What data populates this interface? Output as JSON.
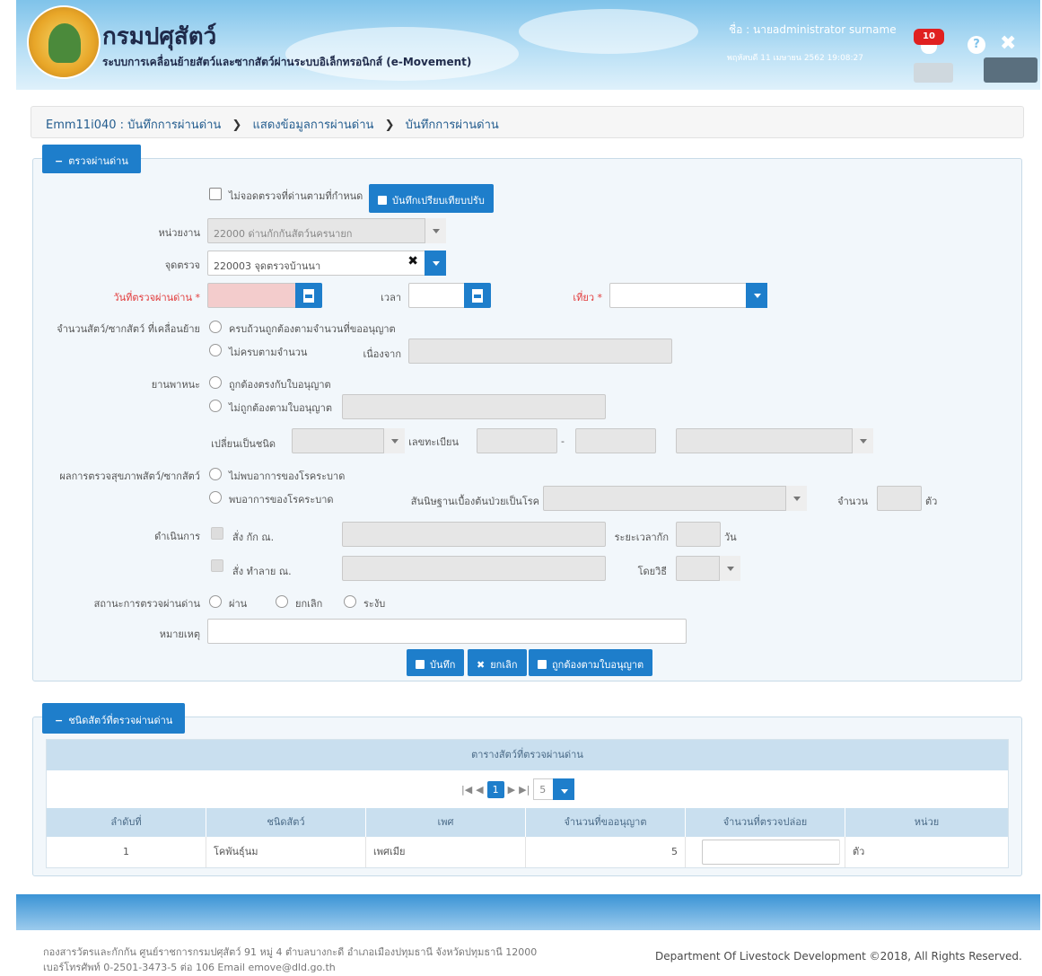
{
  "header": {
    "title": "กรมปศุสัตว์",
    "subtitle": "ระบบการเคลื่อนย้ายสัตว์และซากสัตว์ผ่านระบบอิเล็กทรอนิกส์ (e-Movement)",
    "user": "ชื่อ : นายadministrator surname",
    "datetime": "พฤหัสบดี 11 เมษายน 2562 19:08:27",
    "notification_count": "10"
  },
  "breadcrumb": {
    "items": [
      "Emm11i040 : บันทึกการผ่านด่าน",
      "แสดงข้อมูลการผ่านด่าน",
      "บันทึกการผ่านด่าน"
    ]
  },
  "inspection": {
    "legend": "ตรวจผ่านด่าน",
    "not_at_checkpoint": "ไม่จอดตรวจที่ด่านตามที่กำหนด",
    "save_fine_button": "บันทึกเปรียบเทียบปรับ",
    "unit_label": "หน่วยงาน",
    "unit_value": "22000 ด่านกักกันสัตว์นครนายก",
    "checkpoint_label": "จุดตรวจ",
    "checkpoint_value": "220003 จุดตรวจบ้านนา",
    "date_label": "วันที่ตรวจผ่านด่าน *",
    "time_label": "เวลา",
    "trip_label": "เที่ยว *",
    "animal_count_label": "จำนวนสัตว์/ซากสัตว์ ที่เคลื่อนย้าย",
    "count_complete": "ครบถ้วนถูกต้องตามจำนวนที่ขออนุญาต",
    "count_incomplete": "ไม่ครบตามจำนวน",
    "because_label": "เนื่องจาก",
    "vehicle_label": "ยานพาหนะ",
    "vehicle_ok": "ถูกต้องตรงกับใบอนุญาต",
    "vehicle_not_ok": "ไม่ถูกต้องตามใบอนุญาต",
    "change_type_label": "เปลี่ยนเป็นชนิด",
    "plate_label": "เลขทะเบียน",
    "plate_sep": "-",
    "health_label": "ผลการตรวจสุขภาพสัตว์/ซากสัตว์",
    "health_ok": "ไม่พบอาการของโรคระบาด",
    "health_bad": "พบอาการของโรคระบาด",
    "presumed_label": "สันนิษฐานเบื้องต้นป่วยเป็นโรค",
    "amount_label": "จำนวน",
    "animal_unit": "ตัว",
    "action_label": "ดำเนินการ",
    "quarantine_label": "สั่ง กัก ณ.",
    "duration_label": "ระยะเวลากัก",
    "day_unit": "วัน",
    "destroy_label": "สั่ง ทำลาย ณ.",
    "method_label": "โดยวิธี",
    "status_label": "สถานะการตรวจผ่านด่าน",
    "status_pass": "ผ่าน",
    "status_cancel": "ยกเลิก",
    "status_suspend": "ระงับ",
    "remark_label": "หมายเหตุ",
    "save_button": "บันทึก",
    "cancel_button": "ยกเลิก",
    "match_button": "ถูกต้องตามใบอนุญาต"
  },
  "animals": {
    "legend": "ชนิดสัตว์ที่ตรวจผ่านด่าน",
    "caption": "ตารางสัตว์ที่ตรวจผ่านด่าน",
    "page": "1",
    "page_size": "5",
    "columns": [
      "ลำดับที่",
      "ชนิดสัตว์",
      "เพศ",
      "จำนวนที่ขออนุญาต",
      "จำนวนที่ตรวจปล่อย",
      "หน่วย"
    ],
    "rows": [
      {
        "no": "1",
        "type": "โคพันธุ์นม",
        "sex": "เพศเมีย",
        "requested": "5",
        "released": "",
        "unit": "ตัว"
      }
    ]
  },
  "footer": {
    "address": "กองสารวัตรและกักกัน ศูนย์ราชการกรมปศุสัตว์ 91 หมู่ 4 ตำบลบางกะดี อำเภอเมืองปทุมธานี จังหวัดปทุมธานี 12000",
    "contact": "เบอร์โทรศัพท์ 0-2501-3473-5 ต่อ 106 Email emove@dld.go.th",
    "copyright": "Department Of Livestock Development ©2018, All Rights Reserved."
  }
}
